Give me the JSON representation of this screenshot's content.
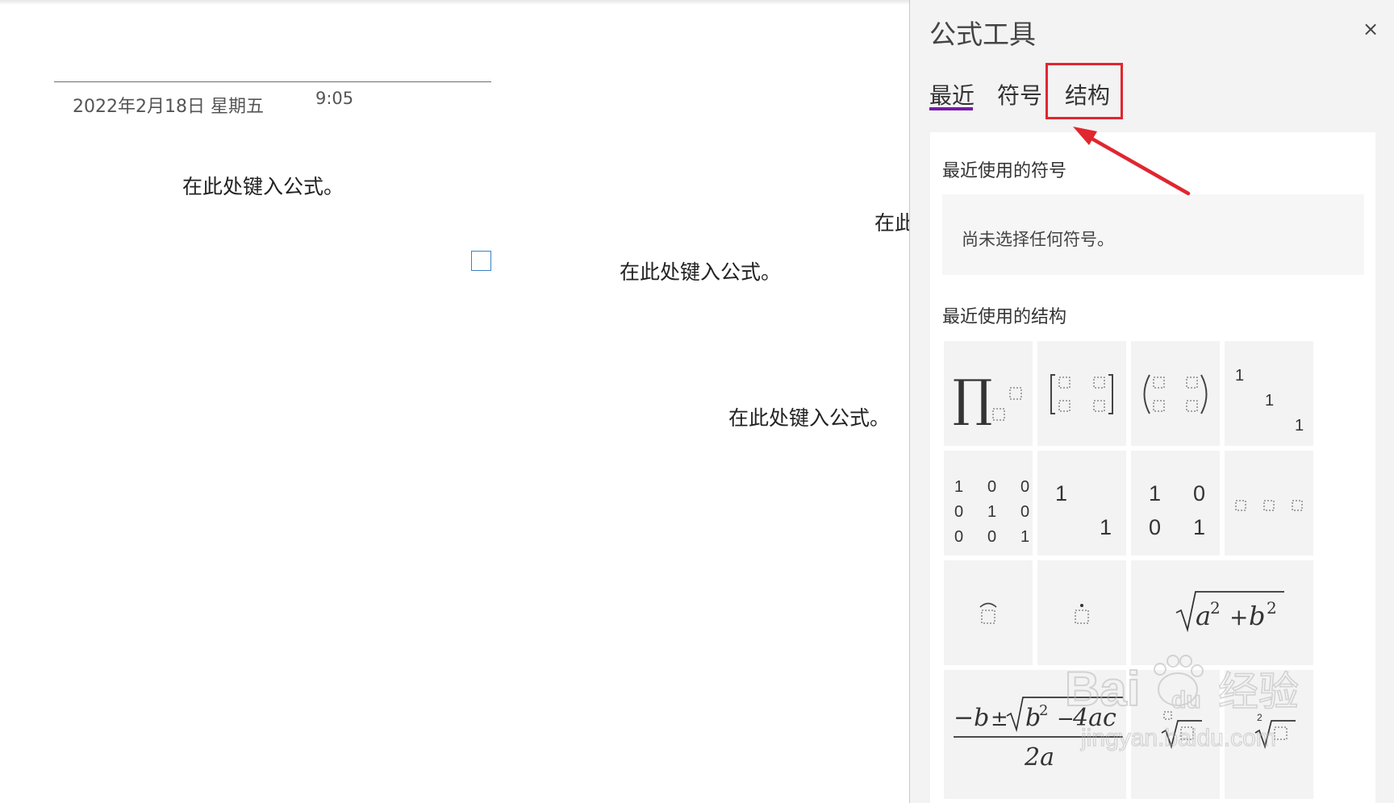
{
  "note": {
    "date": "2022年2月18日 星期五",
    "time": "9:05",
    "equations": [
      "在此处键入公式。",
      "在此处键入公式。",
      "在此处键入公式。",
      "在此处键入公式。"
    ]
  },
  "pane": {
    "title": "公式工具",
    "close_icon": "×",
    "tabs": [
      {
        "label": "最近",
        "active": true
      },
      {
        "label": "符号",
        "active": false
      },
      {
        "label": "结构",
        "active": false,
        "highlighted": true
      }
    ],
    "recent_symbols": {
      "heading": "最近使用的符号",
      "empty_text": "尚未选择任何符号。"
    },
    "recent_structures": {
      "heading": "最近使用的结构",
      "items": [
        {
          "id": "product-subsup",
          "symbol": "∏"
        },
        {
          "id": "bracket-matrix-2x2"
        },
        {
          "id": "paren-matrix-2x2"
        },
        {
          "id": "diagonal-3",
          "cells": [
            "1",
            "1",
            "1"
          ]
        },
        {
          "id": "identity-3x3",
          "rows": [
            [
              "1",
              "0",
              "0"
            ],
            [
              "0",
              "1",
              "0"
            ],
            [
              "0",
              "0",
              "1"
            ]
          ]
        },
        {
          "id": "identity-2x2-sparse",
          "cells": [
            "1",
            "1"
          ]
        },
        {
          "id": "identity-2x2",
          "rows": [
            [
              "1",
              "0"
            ],
            [
              "0",
              "1"
            ]
          ]
        },
        {
          "id": "row-3-empty"
        },
        {
          "id": "arc-accent"
        },
        {
          "id": "dot-accent"
        },
        {
          "id": "pythagoras-root",
          "expr": {
            "a": "a",
            "b": "b",
            "exp": "2",
            "plus": "+"
          }
        },
        {
          "id": "quadratic-formula",
          "numerator": {
            "minus_b": "−b",
            "pm": "±",
            "b": "b",
            "exp": "2",
            "minus": "−",
            "four_ac": "4ac"
          },
          "denominator": "2a"
        },
        {
          "id": "radical-index"
        },
        {
          "id": "radical-2"
        }
      ]
    }
  },
  "colors": {
    "accent_underline": "#7719aa",
    "highlight_red": "#e0262f",
    "placeholder_blue": "#3b82c4"
  },
  "watermark": {
    "logo_text": "Bai",
    "logo_text2": "du",
    "cn_text": "经验",
    "url": "jingyan.baidu.com"
  }
}
